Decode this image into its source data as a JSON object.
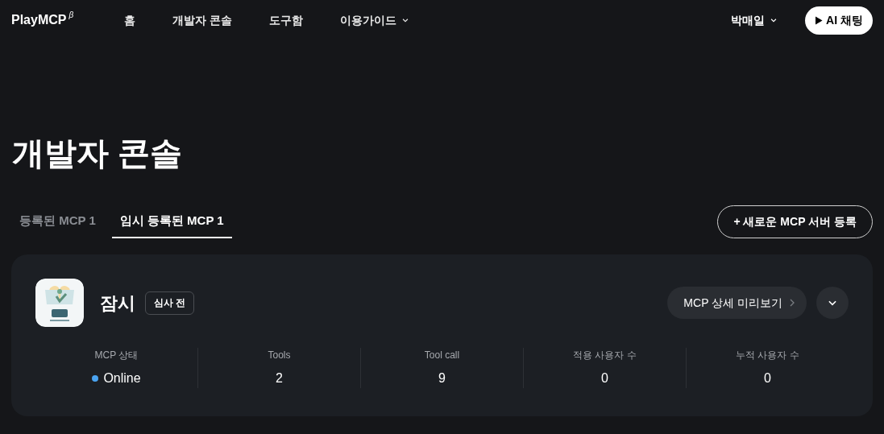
{
  "nav": {
    "logo": "PlayMCP",
    "logo_sup": "β",
    "items": [
      {
        "label": "홈",
        "dropdown": false
      },
      {
        "label": "개발자 콘솔",
        "dropdown": false
      },
      {
        "label": "도구함",
        "dropdown": false
      },
      {
        "label": "이용가이드",
        "dropdown": true
      }
    ],
    "user": "박매일",
    "chat_button": "AI 채팅"
  },
  "page_title": "개발자 콘솔",
  "tabs": [
    {
      "label": "등록된 MCP 1",
      "selected": false
    },
    {
      "label": "임시 등록된 MCP 1",
      "selected": true
    }
  ],
  "add_button": "+ 새로운 MCP 서버 등록",
  "server": {
    "name": "잠시",
    "badge": "심사 전",
    "preview_button": "MCP 상세 미리보기",
    "stats": [
      {
        "label": "MCP 상태",
        "value": "Online",
        "color": "#4aa3f0"
      },
      {
        "label": "Tools",
        "value": "2"
      },
      {
        "label": "Tool call",
        "value": "9"
      },
      {
        "label": "적용 사용자 수",
        "value": "0"
      },
      {
        "label": "누적 사용자 수",
        "value": "0"
      }
    ]
  }
}
